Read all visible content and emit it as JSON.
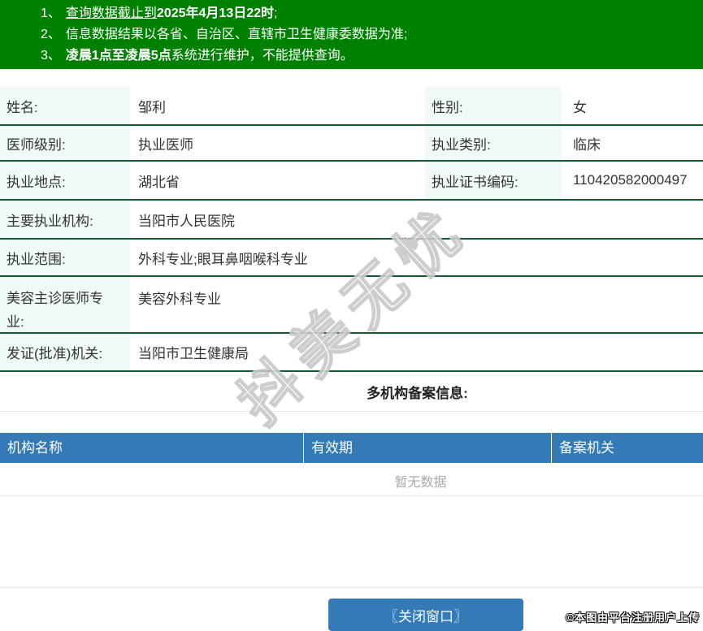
{
  "notice": {
    "bg_color": "#008000",
    "items": [
      {
        "num": "1、",
        "underlined": "查询数据截止到",
        "bold": "2025年4月13日22时",
        "rest": ";"
      },
      {
        "num": "2、",
        "text": "信息数据结果以各省、自治区、直辖市卫生健康委数据为准;"
      },
      {
        "num": "3、",
        "bold": "凌晨1点至凌晨5点",
        "rest": "系统进行维护，不能提供查询。"
      }
    ]
  },
  "profile": {
    "label_bg": "#eefaf3",
    "row_border_color": "#135c33",
    "rows": [
      {
        "label1": "姓名:",
        "value1": "邹利",
        "label2": "性别:",
        "value2": "女"
      },
      {
        "label1": "医师级别:",
        "value1": "执业医师",
        "label2": "执业类别:",
        "value2": "临床"
      },
      {
        "label1": "执业地点:",
        "value1": "湖北省",
        "label2": "执业证书编码:",
        "value2": "110420582000497"
      },
      {
        "label": "主要执业机构:",
        "value": "当阳市人民医院"
      },
      {
        "label": "执业范围:",
        "value": "外科专业;眼耳鼻咽喉科专业"
      },
      {
        "label": "美容主诊医师专业:",
        "value": "美容外科专业"
      },
      {
        "label": "发证(批准)机关:",
        "value": "当阳市卫生健康局"
      }
    ]
  },
  "filing_section": {
    "title": "多机构备案信息:",
    "header_bg": "#337ab7",
    "headers": [
      "机构名称",
      "有效期",
      "备案机关"
    ],
    "empty_text": "暂无数据"
  },
  "footer": {
    "close_button_label": "〖关闭窗口〗",
    "button_color": "#337ab7",
    "copyright": "©本图由平台注册用户上传"
  },
  "watermark_text": "抖美无忧"
}
